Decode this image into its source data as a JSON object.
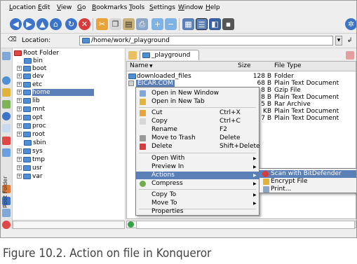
{
  "menu": [
    {
      "label": "Location",
      "u": "L"
    },
    {
      "label": "Edit",
      "u": "E"
    },
    {
      "label": "View",
      "u": "V"
    },
    {
      "label": "Go",
      "u": "G"
    },
    {
      "label": "Bookmarks",
      "u": "B"
    },
    {
      "label": "Tools",
      "u": "T"
    },
    {
      "label": "Settings",
      "u": "S"
    },
    {
      "label": "Window",
      "u": "W"
    },
    {
      "label": "Help",
      "u": "H"
    }
  ],
  "location": {
    "label": "Location:",
    "value": "/home/work/_playground"
  },
  "tree": {
    "root": "Root Folder",
    "items": [
      "bin",
      "boot",
      "dev",
      "etc",
      "home",
      "lib",
      "mnt",
      "opt",
      "proc",
      "root",
      "sbin",
      "sys",
      "tmp",
      "usr",
      "var"
    ],
    "selected": "home",
    "sidebar_label": "Root Folder"
  },
  "tab": {
    "label": "_playground"
  },
  "columns": {
    "name": "Name",
    "size": "Size",
    "type": "File Type"
  },
  "files": [
    {
      "name": "downloaded_files",
      "size": "128 B",
      "type": "Folder"
    },
    {
      "name": "EICAR.COM",
      "size": "68 B",
      "type": "Plain Text Document"
    },
    {
      "name": "",
      "size": "8 B",
      "type": "Gzip File"
    },
    {
      "name": "",
      "size": "8 B",
      "type": "Plain Text Document"
    },
    {
      "name": "",
      "size": "5 B",
      "type": "Rar Archive"
    },
    {
      "name": "",
      "size": "KB",
      "type": "Plain Text Document"
    },
    {
      "name": "",
      "size": "7 B",
      "type": "Plain Text Document"
    }
  ],
  "context_menu": {
    "open_new_window": "Open in New Window",
    "open_new_tab": "Open in New Tab",
    "cut": "Cut",
    "cut_key": "Ctrl+X",
    "copy": "Copy",
    "copy_key": "Ctrl+C",
    "rename": "Rename",
    "rename_key": "F2",
    "trash": "Move to Trash",
    "trash_key": "Delete",
    "delete": "Delete",
    "delete_key": "Shift+Delete",
    "open_with": "Open With",
    "preview_in": "Preview In",
    "actions": "Actions",
    "compress": "Compress",
    "copy_to": "Copy To",
    "move_to": "Move To",
    "properties": "Properties"
  },
  "submenu": {
    "scan": "Scan with BitDefender",
    "encrypt": "Encrypt File",
    "print": "Print..."
  },
  "caption": "Figure 10.2. Action on file in Konqueror"
}
